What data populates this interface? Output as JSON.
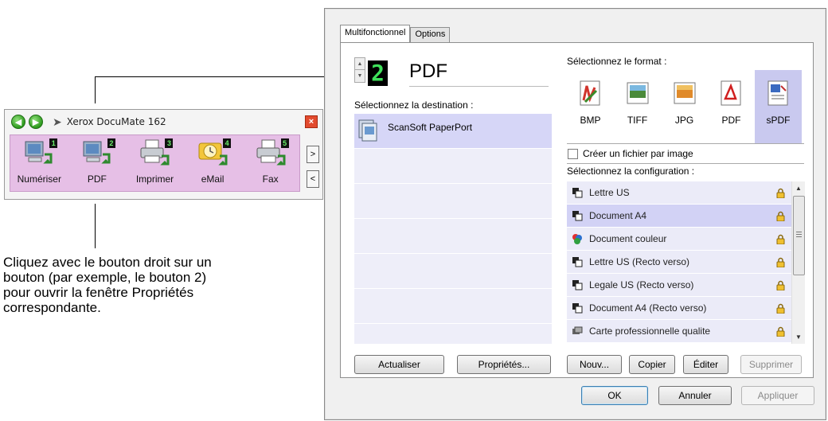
{
  "annotation": {
    "lines": [
      "Cliquez avec le bouton droit sur un",
      "bouton (par exemple, le bouton 2)",
      "pour ouvrir la fenêtre Propriétés",
      "correspondante."
    ]
  },
  "one_touch_panel": {
    "title": "Xerox DocuMate 162",
    "back_icon": "back-arrow-icon",
    "forward_icon": "forward-arrow-icon",
    "close_icon": "close-icon",
    "buttons": [
      {
        "label": "Numériser",
        "number": "1",
        "icon": "scan-to-pc-icon"
      },
      {
        "label": "PDF",
        "number": "2",
        "icon": "scan-to-pdf-icon"
      },
      {
        "label": "Imprimer",
        "number": "3",
        "icon": "printer-icon"
      },
      {
        "label": "eMail",
        "number": "4",
        "icon": "email-icon"
      },
      {
        "label": "Fax",
        "number": "5",
        "icon": "fax-icon"
      }
    ],
    "next_label": ">",
    "prev_label": "<"
  },
  "dialog": {
    "tabs": [
      {
        "label": "Multifonctionnel",
        "active": true
      },
      {
        "label": "Options",
        "active": false
      }
    ],
    "button_number": "2",
    "button_name": "PDF",
    "destination_label": "Sélectionnez la destination :",
    "destinations": [
      {
        "label": "ScanSoft PaperPort",
        "selected": true,
        "icon": "paperport-icon"
      },
      {
        "label": "",
        "selected": false
      },
      {
        "label": "",
        "selected": false
      },
      {
        "label": "",
        "selected": false
      },
      {
        "label": "",
        "selected": false
      },
      {
        "label": "",
        "selected": false
      },
      {
        "label": "",
        "selected": false
      }
    ],
    "refresh_button": "Actualiser",
    "properties_button": "Propriétés...",
    "format_label": "Sélectionnez le format :",
    "formats": [
      {
        "label": "BMP",
        "selected": false,
        "icon": "bmp-icon"
      },
      {
        "label": "TIFF",
        "selected": false,
        "icon": "tiff-icon"
      },
      {
        "label": "JPG",
        "selected": false,
        "icon": "jpg-icon"
      },
      {
        "label": "PDF",
        "selected": false,
        "icon": "pdf-icon"
      },
      {
        "label": "sPDF",
        "selected": true,
        "icon": "spdf-icon"
      }
    ],
    "one_file_per_image": {
      "label": "Créer un fichier par image",
      "checked": false
    },
    "config_label": "Sélectionnez la configuration :",
    "configurations": [
      {
        "label": "Lettre US",
        "selected": false,
        "icon": "bw-config-icon"
      },
      {
        "label": "Document A4",
        "selected": true,
        "icon": "bw-config-icon"
      },
      {
        "label": "Document couleur",
        "selected": false,
        "icon": "color-config-icon"
      },
      {
        "label": "Lettre US (Recto verso)",
        "selected": false,
        "icon": "bw-config-icon"
      },
      {
        "label": "Legale US (Recto verso)",
        "selected": false,
        "icon": "bw-config-icon"
      },
      {
        "label": "Document A4 (Recto verso)",
        "selected": false,
        "icon": "bw-config-icon"
      },
      {
        "label": "Carte professionnelle qualite",
        "selected": false,
        "icon": "card-config-icon"
      }
    ],
    "new_button": "Nouv...",
    "copy_button": "Copier",
    "edit_button": "Éditer",
    "delete_button": "Supprimer",
    "ok_button": "OK",
    "cancel_button": "Annuler",
    "apply_button": "Appliquer",
    "colors": {
      "panel_button_bg": "#e6bfe6",
      "selected_row": "#d2d2f5",
      "digit_green": "#3fe05a"
    }
  }
}
